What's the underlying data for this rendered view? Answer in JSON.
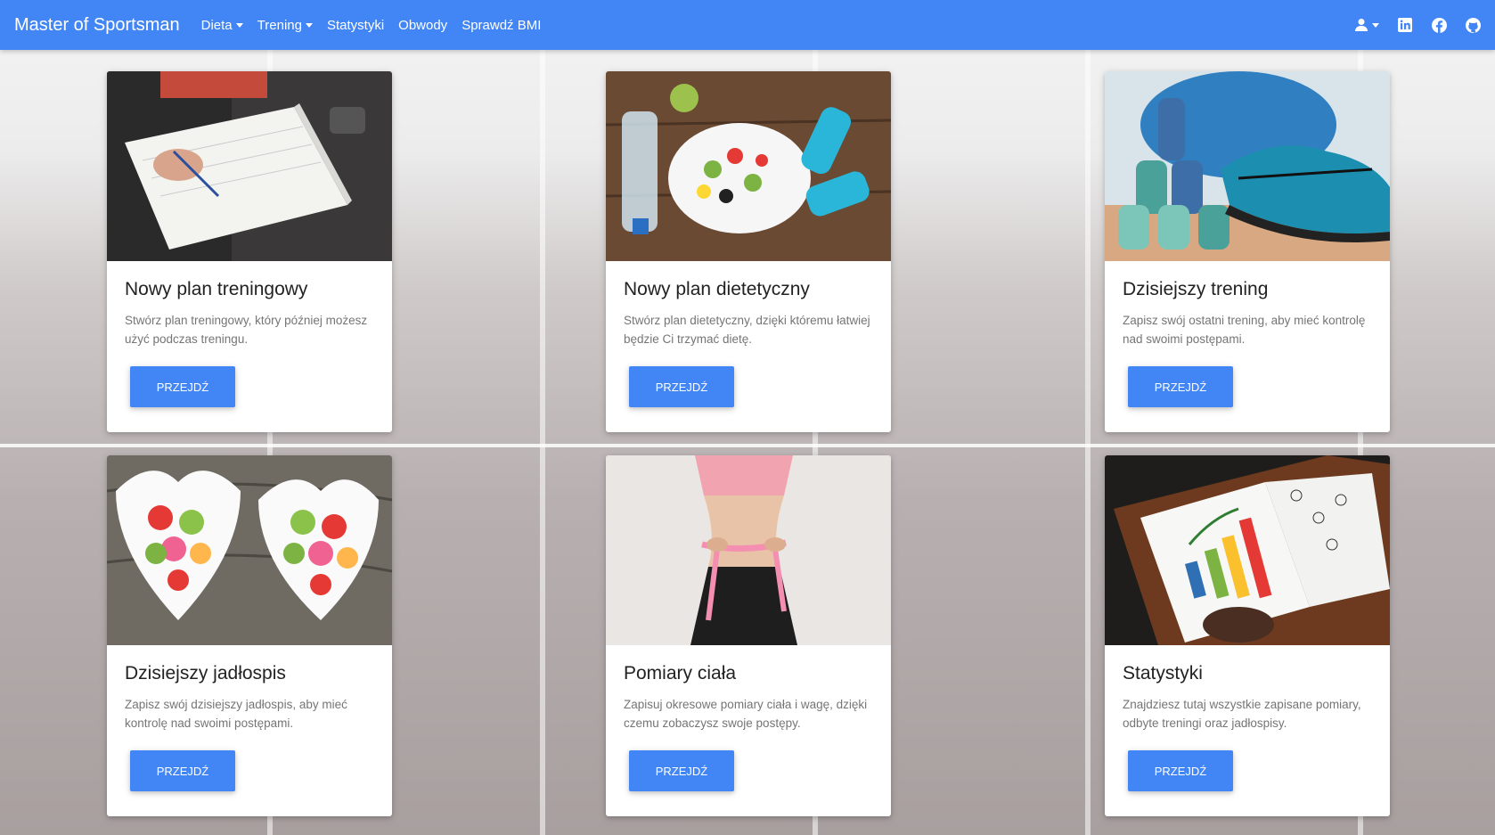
{
  "navbar": {
    "brand": "Master of Sportsman",
    "links": [
      "Dieta",
      "Trening",
      "Statystyki",
      "Obwody",
      "Sprawdź BMI"
    ],
    "icons": [
      "user-icon",
      "linkedin-icon",
      "facebook-icon",
      "github-icon"
    ]
  },
  "cards": [
    {
      "title": "Nowy plan treningowy",
      "text": "Stwórz plan treningowy, który później możesz użyć podczas treningu.",
      "button": "PRZEJDŹ",
      "image": "notebook-writing-image"
    },
    {
      "title": "Nowy plan dietetyczny",
      "text": "Stwórz plan dietetyczny, dzięki któremu łatwiej będzie Ci trzymać dietę.",
      "button": "PRZEJDŹ",
      "image": "salad-dumbbells-image"
    },
    {
      "title": "Dzisiejszy trening",
      "text": "Zapisz swój ostatni trening, aby mieć kontrolę nad swoimi postępami.",
      "button": "PRZEJDŹ",
      "image": "dumbbells-shoe-image"
    },
    {
      "title": "Dzisiejszy jadłospis",
      "text": "Zapisz swój dzisiejszy jadłospis, aby mieć kontrolę nad swoimi postępami.",
      "button": "PRZEJDŹ",
      "image": "fruit-bowls-image"
    },
    {
      "title": "Pomiary ciała",
      "text": "Zapisuj okresowe pomiary ciała i wagę, dzięki czemu zobaczysz swoje postępy.",
      "button": "PRZEJDŹ",
      "image": "waist-measure-image"
    },
    {
      "title": "Statystyki",
      "text": "Znajdziesz tutaj wszystkie zapisane pomiary, odbyte treningi oraz jadłospisy.",
      "button": "PRZEJDŹ",
      "image": "chart-notebook-image"
    }
  ],
  "colors": {
    "accent": "#4285f4"
  }
}
